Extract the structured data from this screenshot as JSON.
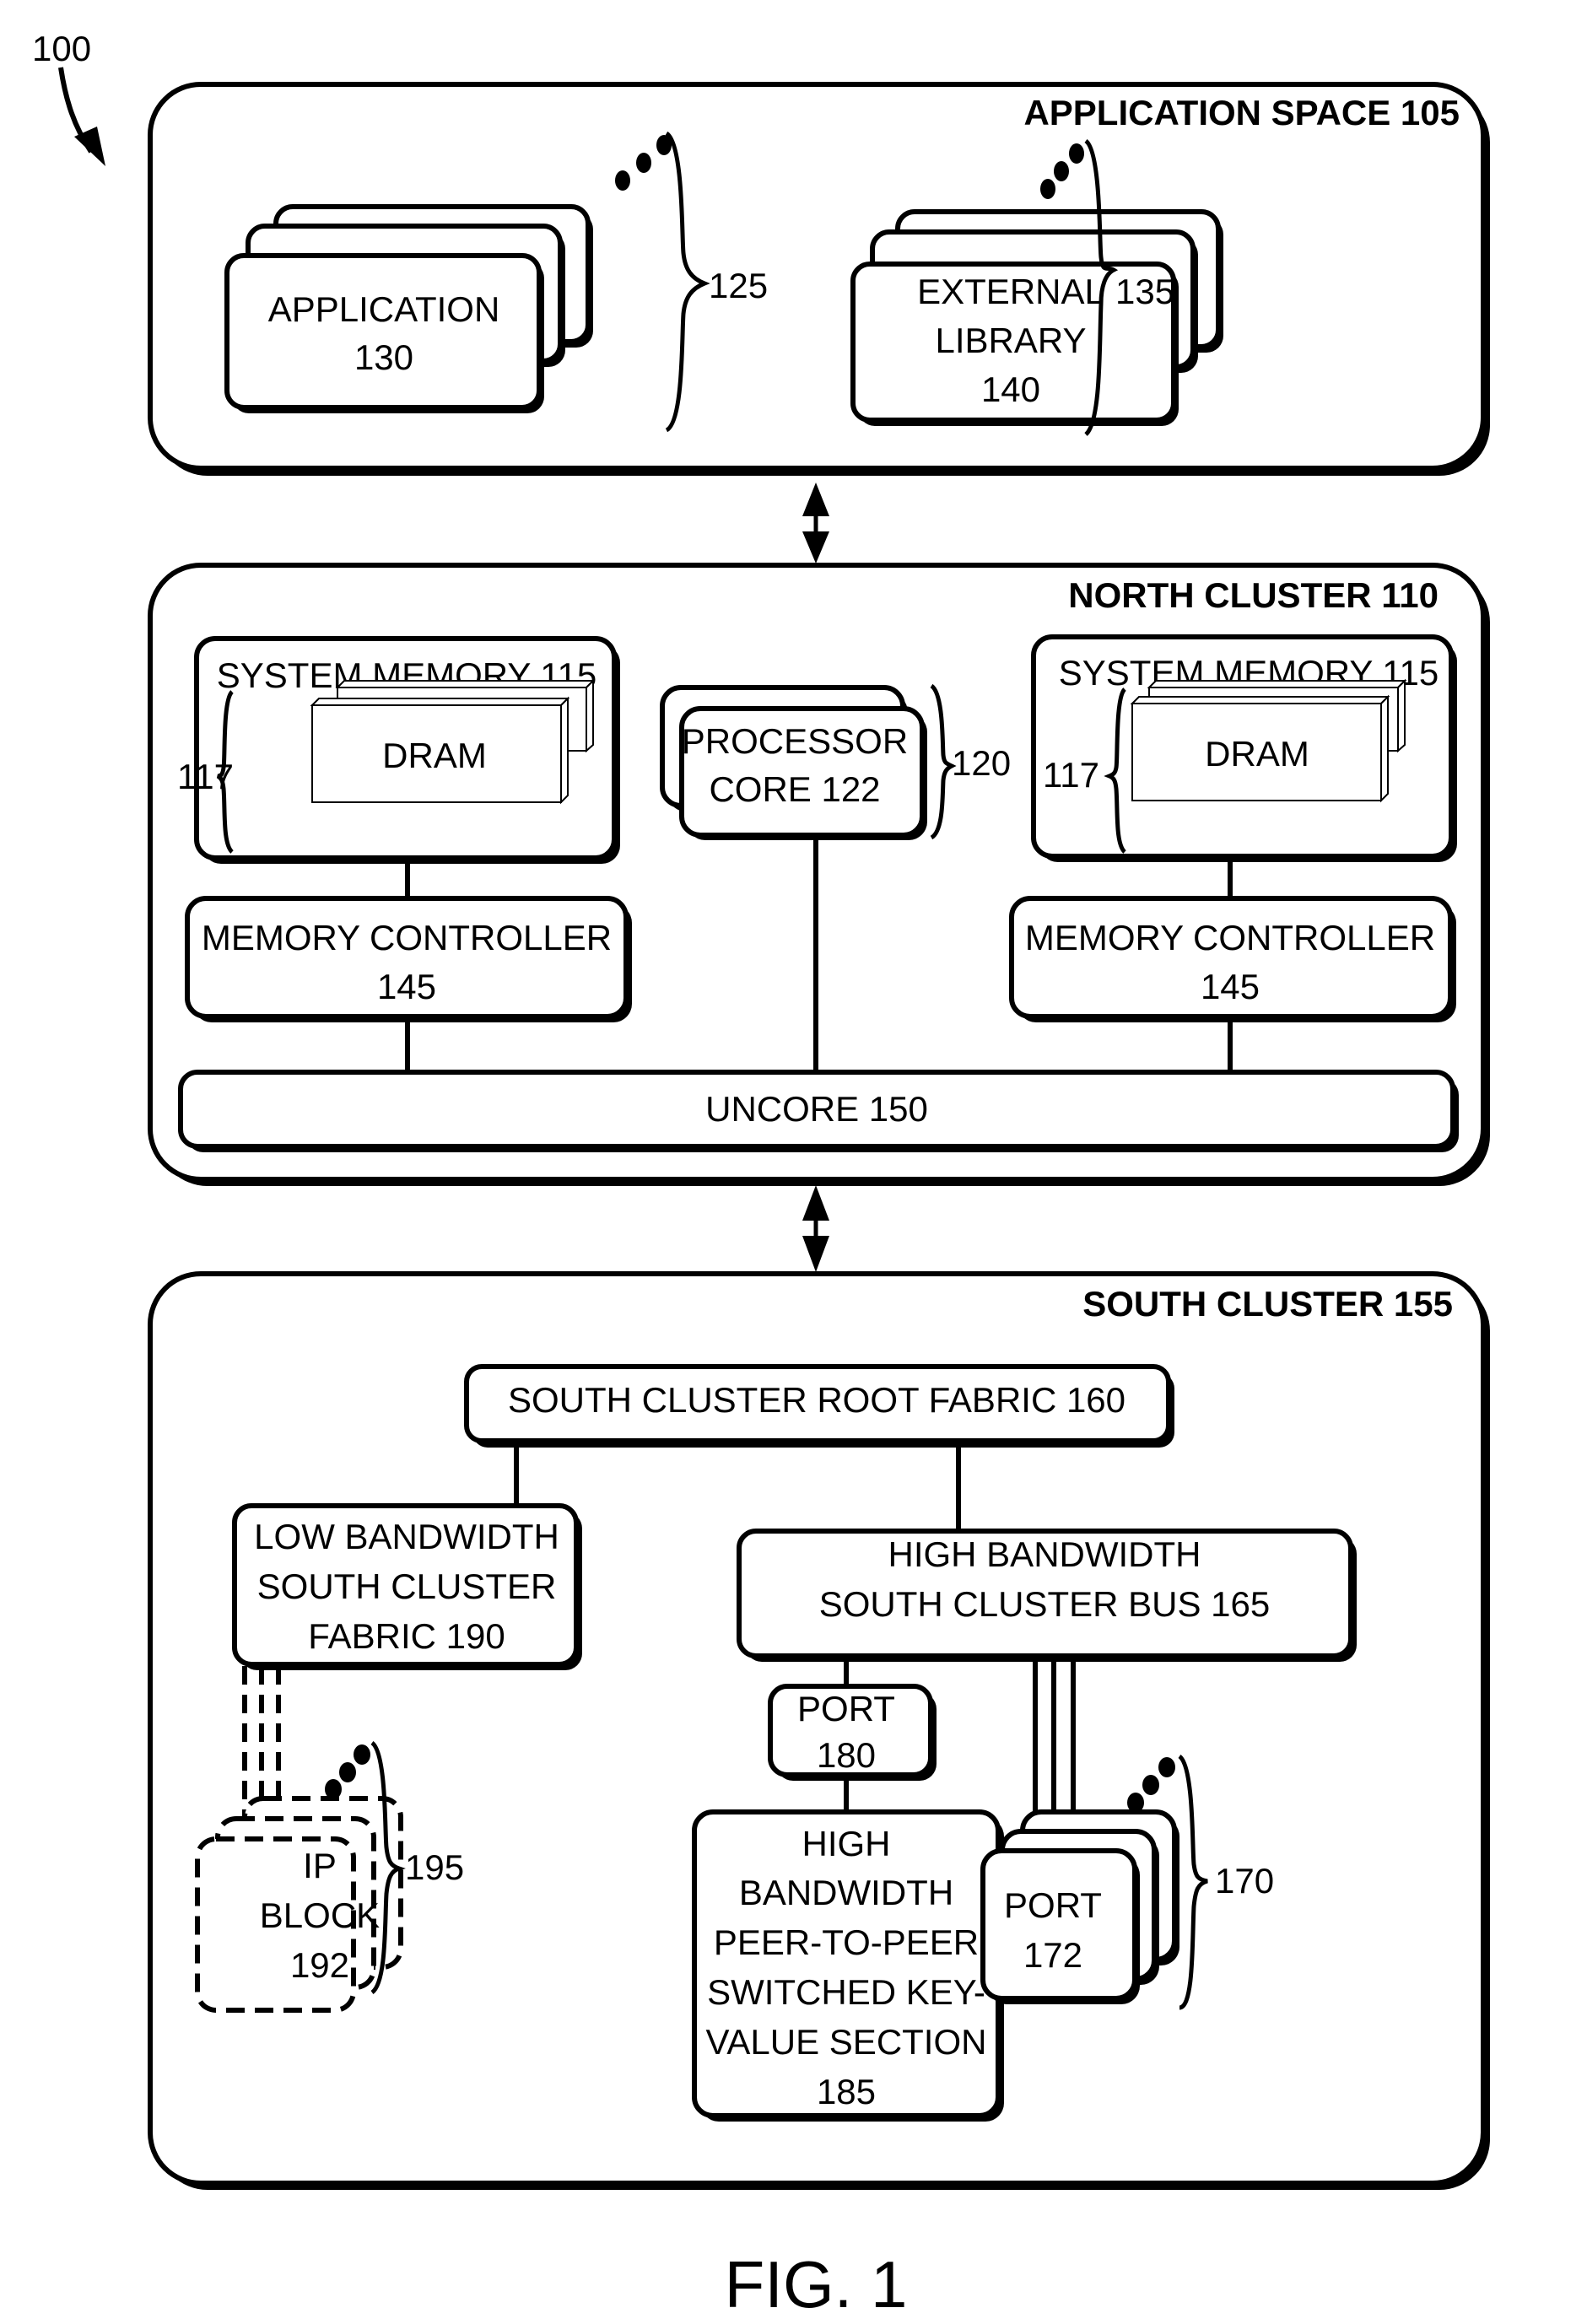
{
  "figure": {
    "ref_number": "100",
    "caption": "FIG. 1"
  },
  "application_space": {
    "title": "APPLICATION SPACE 105",
    "application": {
      "line1": "APPLICATION",
      "line2": "130"
    },
    "application_group_ref": "125",
    "external_library": {
      "line1": "EXTERNAL",
      "line2": "LIBRARY",
      "line3": "140"
    },
    "external_library_group_ref": "135"
  },
  "north_cluster": {
    "title": "NORTH CLUSTER 110",
    "system_memory_left": {
      "title": "SYSTEM MEMORY 115",
      "dram_label": "DRAM",
      "dram_group_ref": "117"
    },
    "system_memory_right": {
      "title": "SYSTEM MEMORY 115",
      "dram_label": "DRAM",
      "dram_group_ref": "117"
    },
    "processor_core": {
      "line1": "PROCESSOR",
      "line2": "CORE 122"
    },
    "processor_group_ref": "120",
    "memory_controller_left": {
      "line1": "MEMORY CONTROLLER",
      "line2": "145"
    },
    "memory_controller_right": {
      "line1": "MEMORY CONTROLLER",
      "line2": "145"
    },
    "uncore": "UNCORE 150"
  },
  "south_cluster": {
    "title": "SOUTH CLUSTER 155",
    "root_fabric": "SOUTH CLUSTER ROOT FABRIC 160",
    "low_bandwidth_fabric": {
      "line1": "LOW BANDWIDTH",
      "line2": "SOUTH CLUSTER",
      "line3": "FABRIC 190"
    },
    "high_bandwidth_bus": {
      "line1": "HIGH BANDWIDTH",
      "line2": "SOUTH CLUSTER BUS 165"
    },
    "port_180": {
      "line1": "PORT",
      "line2": "180"
    },
    "key_value_section": {
      "lines": [
        "HIGH",
        "BANDWIDTH",
        "PEER-TO-PEER",
        "SWITCHED KEY-",
        "VALUE SECTION",
        "185"
      ]
    },
    "ip_block": {
      "line1": "IP",
      "line2": "BLOCK",
      "line3": "192"
    },
    "ip_block_group_ref": "195",
    "port_172": {
      "line1": "PORT",
      "line2": "172"
    },
    "port_group_ref": "170"
  }
}
